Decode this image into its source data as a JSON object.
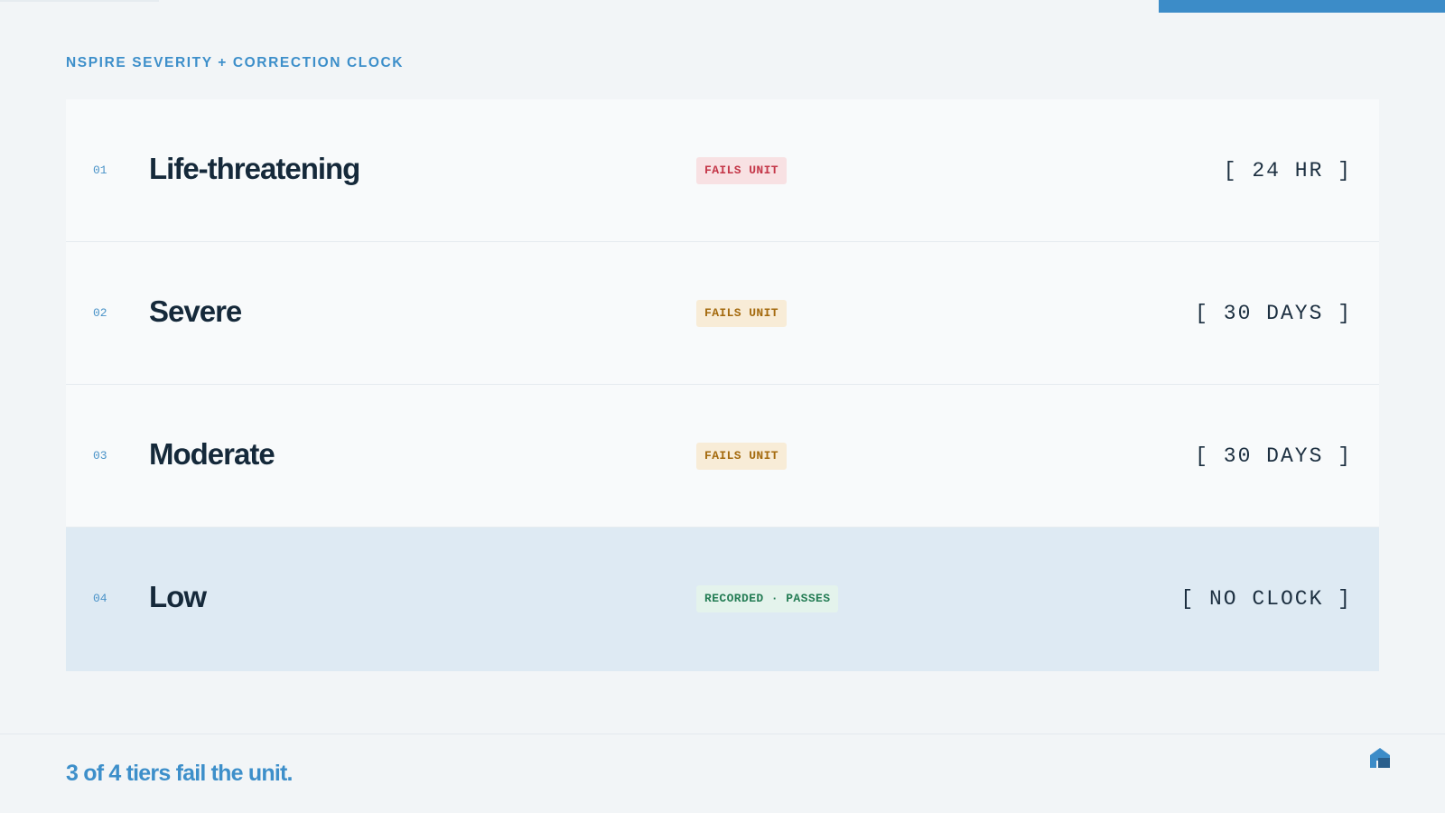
{
  "header": {
    "eyebrow": "NSPIRE SEVERITY + CORRECTION CLOCK"
  },
  "tiers": [
    {
      "number": "01",
      "name": "Life-threatening",
      "badge": "FAILS UNIT",
      "badge_tone": "red",
      "clock": "[ 24 HR ]",
      "highlighted": false
    },
    {
      "number": "02",
      "name": "Severe",
      "badge": "FAILS UNIT",
      "badge_tone": "amber",
      "clock": "[ 30 DAYS ]",
      "highlighted": false
    },
    {
      "number": "03",
      "name": "Moderate",
      "badge": "FAILS UNIT",
      "badge_tone": "amber",
      "clock": "[ 30 DAYS ]",
      "highlighted": false
    },
    {
      "number": "04",
      "name": "Low",
      "badge": "RECORDED · PASSES",
      "badge_tone": "green",
      "clock": "[ NO CLOCK ]",
      "highlighted": true
    }
  ],
  "footer": {
    "summary": "3 of 4 tiers fail the unit.",
    "logo_icon": "house-logo-icon"
  },
  "colors": {
    "accent": "#3c8cc8",
    "fail_red": "#c43648",
    "fail_amber": "#a46a0e",
    "pass_green": "#257d55",
    "highlight_row": "#deeaf3"
  }
}
